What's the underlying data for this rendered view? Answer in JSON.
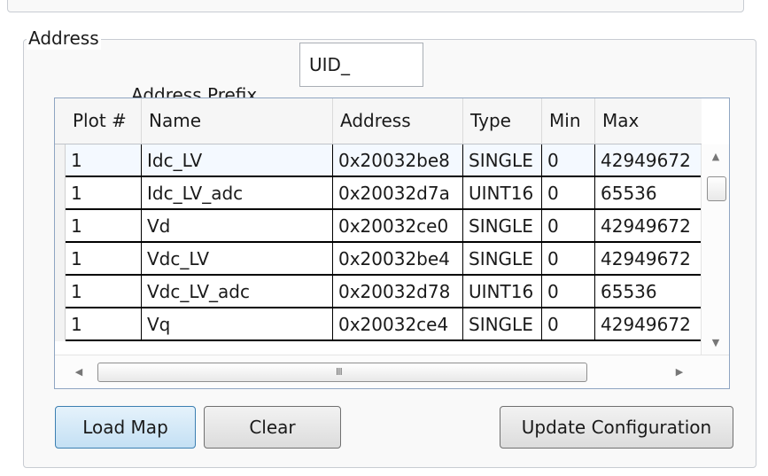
{
  "address_group": {
    "title": "Address",
    "prefix_label": "Address Prefix",
    "prefix_value": "UID_"
  },
  "grid": {
    "columns": [
      "Plot #",
      "Name",
      "Address",
      "Type",
      "Min",
      "Max"
    ],
    "rows": [
      [
        "1",
        "Idc_LV",
        "0x20032be8",
        "SINGLE",
        "0",
        "42949672"
      ],
      [
        "1",
        "Idc_LV_adc",
        "0x20032d7a",
        "UINT16",
        "0",
        "65536"
      ],
      [
        "1",
        "Vd",
        "0x20032ce0",
        "SINGLE",
        "0",
        "42949672"
      ],
      [
        "1",
        "Vdc_LV",
        "0x20032be4",
        "SINGLE",
        "0",
        "42949672"
      ],
      [
        "1",
        "Vdc_LV_adc",
        "0x20032d78",
        "UINT16",
        "0",
        "65536"
      ],
      [
        "1",
        "Vq",
        "0x20032ce4",
        "SINGLE",
        "0",
        "42949672"
      ]
    ],
    "scroll_up_icon": "▲",
    "scroll_down_icon": "▼",
    "scroll_left_icon": "◀",
    "scroll_right_icon": "▶",
    "grip_icon": "III"
  },
  "buttons": {
    "load_map": "Load Map",
    "clear": "Clear",
    "update_configuration": "Update Configuration"
  },
  "colors": {
    "focused_button": "#c4e0f4",
    "grid_border": "#8fa5c2"
  }
}
